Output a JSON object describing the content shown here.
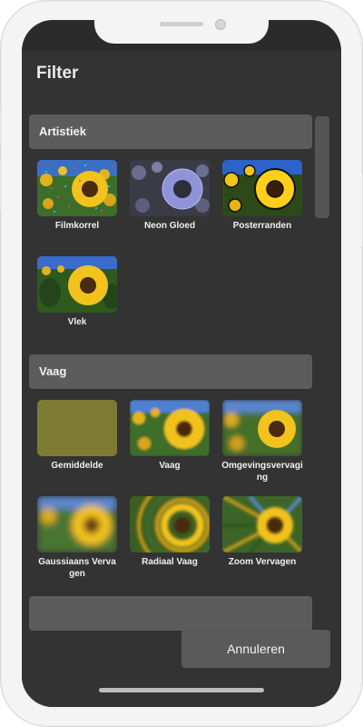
{
  "dialog": {
    "title": "Filter",
    "cancel_label": "Annuleren"
  },
  "categories": [
    {
      "label": "Artistiek",
      "filters": [
        {
          "label": "Filmkorrel",
          "icon": "sunflower-grain-thumbnail"
        },
        {
          "label": "Neon Gloed",
          "icon": "sunflower-neon-thumbnail"
        },
        {
          "label": "Posterranden",
          "icon": "sunflower-poster-thumbnail"
        },
        {
          "label": "Vlek",
          "icon": "sunflower-stain-thumbnail"
        }
      ]
    },
    {
      "label": "Vaag",
      "filters": [
        {
          "label": "Gemiddelde",
          "icon": "olive-average-thumbnail"
        },
        {
          "label": "Vaag",
          "icon": "sunflower-blur-thumbnail"
        },
        {
          "label": "Omgevingsvervaging",
          "icon": "sunflower-ambient-blur-thumbnail"
        },
        {
          "label": "Gaussiaans Vervagen",
          "icon": "sunflower-gaussian-thumbnail"
        },
        {
          "label": "Radiaal Vaag",
          "icon": "sunflower-radial-thumbnail"
        },
        {
          "label": "Zoom Vervagen",
          "icon": "sunflower-zoom-thumbnail"
        }
      ]
    },
    {
      "label": ""
    }
  ],
  "colors": {
    "background": "#333333",
    "category_header": "#5c5c5c",
    "button": "#5a5a5a",
    "average_thumb": "#7d7a33"
  }
}
